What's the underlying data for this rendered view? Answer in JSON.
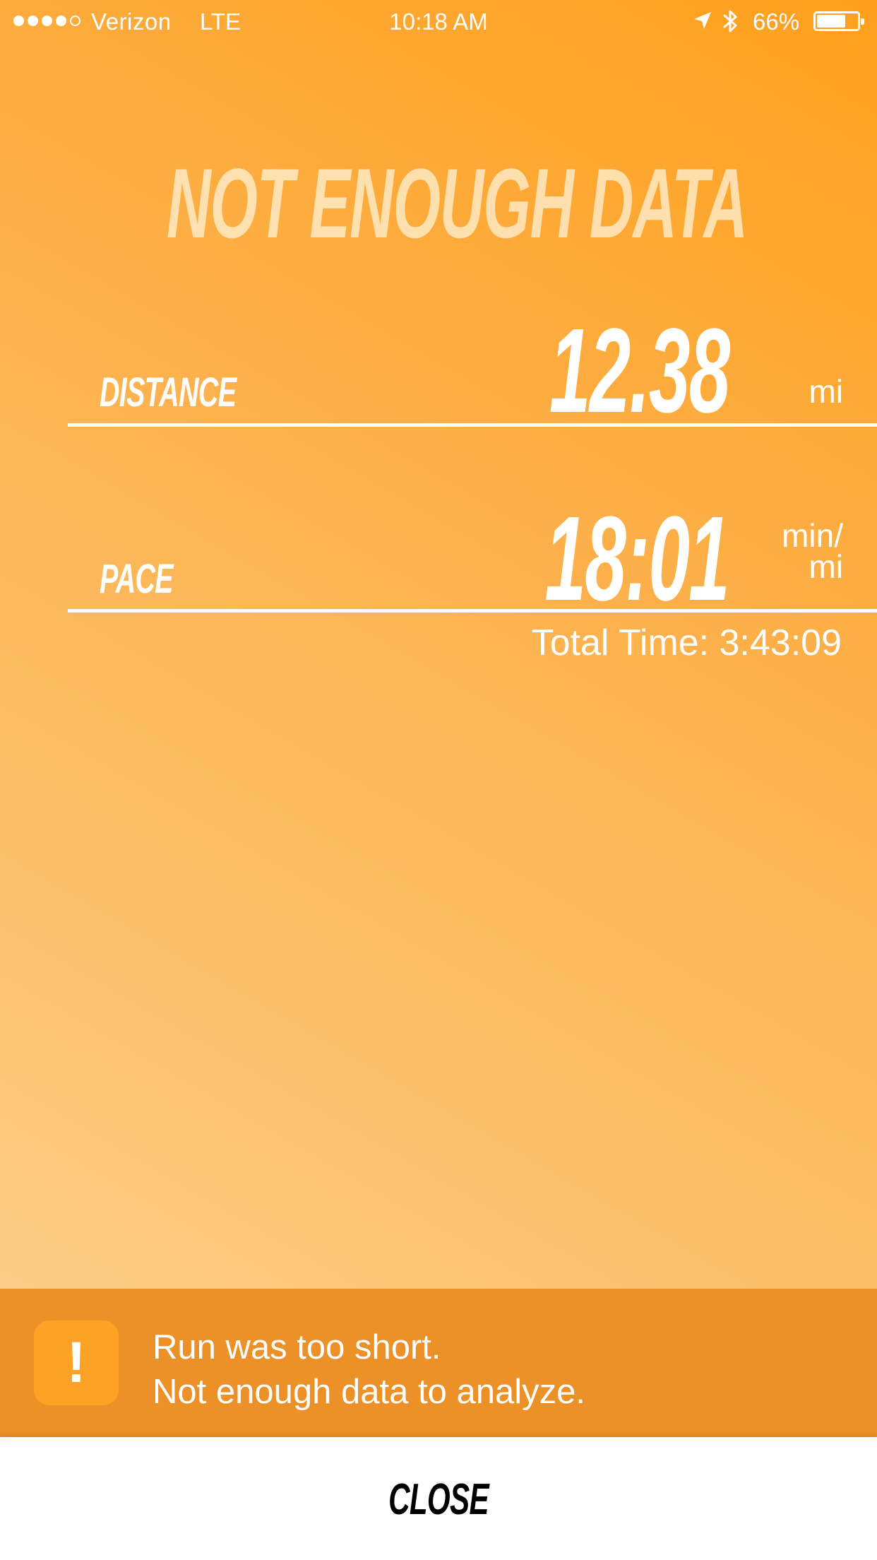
{
  "status_bar": {
    "carrier": "Verizon",
    "network": "LTE",
    "time": "10:18 AM",
    "battery_percent": "66%",
    "signal_bars_filled": 4,
    "signal_bars_total": 5,
    "icons": [
      "location-icon",
      "bluetooth-icon",
      "battery-icon"
    ]
  },
  "headline": "NOT ENOUGH DATA",
  "metrics": {
    "distance": {
      "label": "DISTANCE",
      "value": "12.38",
      "unit": "mi"
    },
    "pace": {
      "label": "PACE",
      "value": "18:01",
      "unit_line1": "min/",
      "unit_line2": "mi"
    }
  },
  "total_time": "Total Time: 3:43:09",
  "alert": {
    "icon": "exclamation-icon",
    "icon_glyph": "!",
    "line1": "Run was too short.",
    "line2": "Not enough data to analyze."
  },
  "close_button": "CLOSE",
  "colors": {
    "accent": "#ffa01c",
    "alert_background": "#ec9028",
    "alert_icon_background": "#fea225",
    "text_light": "#ffffff"
  }
}
